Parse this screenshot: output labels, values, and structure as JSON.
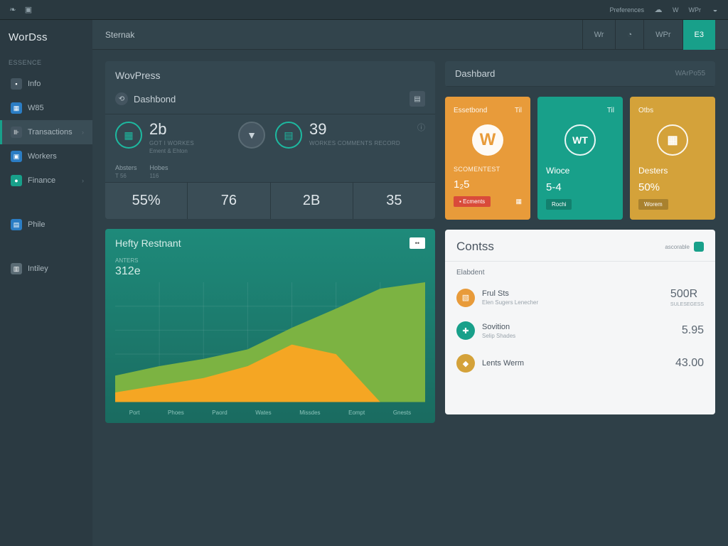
{
  "topbar": {
    "right_label": "Preferences",
    "right_items": [
      "W",
      "WPr"
    ]
  },
  "brand": "WorDss",
  "sidebar": {
    "section": "Essence",
    "items": [
      {
        "label": "Info",
        "icon_class": "dark"
      },
      {
        "label": "W85",
        "icon_class": "blue"
      },
      {
        "label": "Transactions",
        "icon_class": "dark",
        "active": true,
        "chevron": true
      },
      {
        "label": "Workers",
        "icon_class": "blue"
      },
      {
        "label": "Finance",
        "icon_class": "teal",
        "chevron": true
      },
      {
        "label": "Phile",
        "icon_class": "blue"
      },
      {
        "label": "Intiley",
        "icon_class": "gray"
      }
    ]
  },
  "header": {
    "crumb": "Sternak",
    "tabs": [
      {
        "label": "Wr",
        "icon": "◐"
      },
      {
        "label": "◔",
        "icon": ""
      },
      {
        "label": "WPr",
        "icon": ""
      },
      {
        "label": "E3",
        "green": true
      }
    ]
  },
  "dashboard": {
    "brand2": "WovPress",
    "panel_title": "Dashbond",
    "stats": [
      {
        "value": "2b",
        "line1": "Got I Workes",
        "line2": "Ement & Ehton",
        "icon": "▦"
      },
      {
        "value": "39",
        "line1": "Workes Comments Record",
        "line2": "",
        "icon": "▤",
        "dark": true
      }
    ],
    "meta": [
      {
        "k": "Absters",
        "v": "T 56"
      },
      {
        "k": "Hobes",
        "v": "116"
      }
    ],
    "numbers": [
      "55%",
      "76",
      "2B",
      "35"
    ]
  },
  "right_header": {
    "title": "Dashbard",
    "sub": "WArPo55"
  },
  "tiles": [
    {
      "color": "orange",
      "top_l": "Essetbond",
      "top_r": "Til",
      "logo": "W",
      "lbl": "Scomentest",
      "name": "",
      "val": "1₂5",
      "foot_l": "Ecments",
      "btn": "",
      "btn_red": true
    },
    {
      "color": "teal",
      "top_l": "",
      "top_r": "Til",
      "logo": "WT",
      "ring": true,
      "lbl": "",
      "name": "Wioce",
      "val": "5-4",
      "foot_l": "",
      "btn": "Rochi"
    },
    {
      "color": "amber",
      "top_l": "Otbs",
      "top_r": "",
      "logo": "▦",
      "ring": true,
      "lbl": "",
      "name": "Desters",
      "val": "50%",
      "foot_l": "",
      "btn": "Worem"
    }
  ],
  "chart": {
    "title": "Hefty Restnant",
    "sublbl": "Anters",
    "subval": "312e",
    "badge": "••",
    "yaxis": [
      "",
      "",
      "",
      ""
    ],
    "xaxis": [
      "Port",
      "Phoes",
      "Paord",
      "Wates",
      "Missdes",
      "Eompt",
      "Gnests"
    ]
  },
  "chart_data": {
    "type": "area",
    "categories": [
      "Port",
      "Phoes",
      "Paord",
      "Wates",
      "Missdes",
      "Eompt",
      "Gnests"
    ],
    "series": [
      {
        "name": "green",
        "values": [
          22,
          30,
          36,
          44,
          62,
          78,
          95
        ]
      },
      {
        "name": "orange",
        "values": [
          8,
          14,
          20,
          30,
          48,
          40,
          0
        ]
      }
    ],
    "ylim": [
      0,
      100
    ]
  },
  "contacts": {
    "title": "Contss",
    "badge": "ascorable",
    "sub": "Elabdent",
    "rows": [
      {
        "icon": "orange",
        "glyph": "▧",
        "name": "Frul Sts",
        "desc": "Elen Sugers Lenecher",
        "val": "500R",
        "vs": "SULESEGESS"
      },
      {
        "icon": "teal",
        "glyph": "✚",
        "name": "Sovition",
        "desc": "Selip Shades",
        "val": "5.95",
        "vs": ""
      },
      {
        "icon": "amber",
        "glyph": "◆",
        "name": "Lents Werm",
        "desc": "",
        "val": "43.00",
        "vs": ""
      }
    ]
  }
}
